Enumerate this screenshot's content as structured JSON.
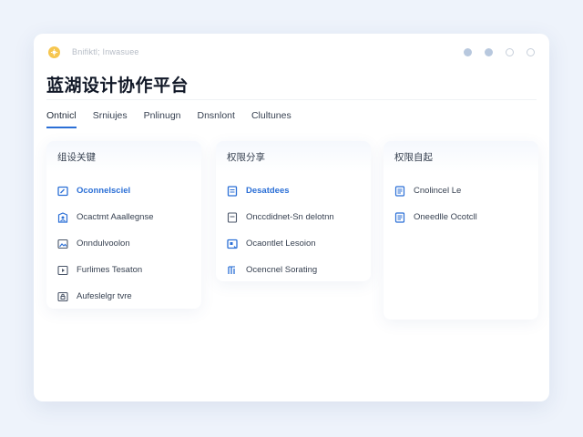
{
  "app": {
    "subtitle": "Bnifiktl; Inwasuee",
    "title": "蓝湖设计协作平台"
  },
  "window_controls": [
    "dot-filled-icon",
    "dot-filled-icon",
    "dot-outline-icon",
    "dot-outline-icon"
  ],
  "tabs": [
    {
      "label": "Ontnicl",
      "active": true
    },
    {
      "label": "Srniujes",
      "active": false
    },
    {
      "label": "Pnlinugn",
      "active": false
    },
    {
      "label": "Dnsnlont",
      "active": false
    },
    {
      "label": "Clultunes",
      "active": false
    }
  ],
  "cards": [
    {
      "title": "组设关键",
      "items": [
        {
          "label": "Oconnelsciel",
          "icon": "document-edit-icon",
          "active": true
        },
        {
          "label": "Ocactmt Aaallegnse",
          "icon": "user-shield-icon",
          "active": false
        },
        {
          "label": "Onndulvoolon",
          "icon": "image-icon",
          "active": false
        },
        {
          "label": "Furlimes Tesaton",
          "icon": "play-square-icon",
          "active": false
        },
        {
          "label": "Aufeslelgr tvre",
          "icon": "lock-square-icon",
          "active": false
        }
      ]
    },
    {
      "title": "权限分享",
      "items": [
        {
          "label": "Desatdees",
          "icon": "file-text-icon",
          "active": true
        },
        {
          "label": "Onccdidnet-Sn delotnn",
          "icon": "file-outline-icon",
          "active": false
        },
        {
          "label": "Ocaontlet Lesoion",
          "icon": "slides-icon",
          "active": false
        },
        {
          "label": "Ocencnel Sorating",
          "icon": "columns-icon",
          "active": false
        }
      ]
    },
    {
      "title": "权限自起",
      "items": [
        {
          "label": "Cnolincel Le",
          "icon": "doc-lines-icon",
          "active": false
        },
        {
          "label": "Oneedlle Ocotcll",
          "icon": "doc-lines-icon",
          "active": false
        }
      ]
    }
  ],
  "colors": {
    "accent": "#2b6fd6",
    "background": "#eef3fb",
    "logo": "#f6c64f"
  }
}
